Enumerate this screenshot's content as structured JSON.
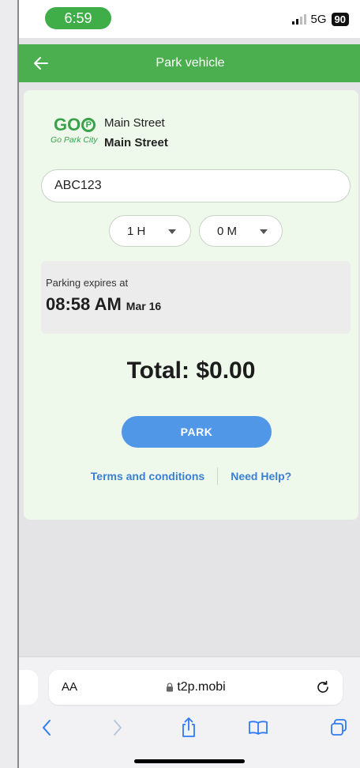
{
  "status_bar": {
    "time": "6:59",
    "network": "5G",
    "battery": "90"
  },
  "header": {
    "title": "Park vehicle"
  },
  "location": {
    "logo_text": "GO",
    "logo_letter": "P",
    "logo_subtitle": "Go Park City",
    "line1": "Main Street",
    "line2": "Main Street"
  },
  "plate": {
    "value": "ABC123"
  },
  "duration": {
    "hours": "1 H",
    "minutes": "0 M"
  },
  "expiry": {
    "label": "Parking expires at",
    "time": "08:58 AM",
    "date": "Mar 16"
  },
  "total": {
    "text": "Total: $0.00"
  },
  "actions": {
    "park_label": "PARK",
    "terms_label": "Terms and conditions",
    "help_label": "Need Help?"
  },
  "browser": {
    "text_size_label": "AA",
    "url": "t2p.mobi"
  },
  "colors": {
    "header_green": "#4bae4f",
    "card_bg": "#eef9ec",
    "park_blue": "#5197e8",
    "link_blue": "#3b7fd5"
  }
}
